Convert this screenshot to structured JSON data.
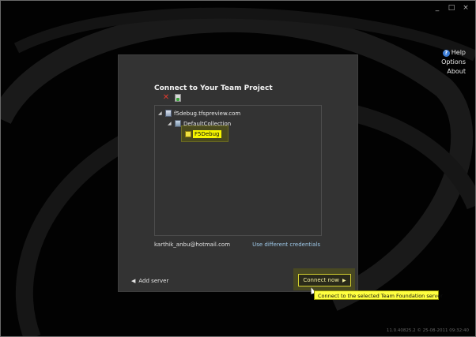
{
  "window": {
    "minimize": "_",
    "maximize": "□",
    "close": "×"
  },
  "links": {
    "help": "Help",
    "options": "Options",
    "about": "About"
  },
  "dialog": {
    "title": "Connect to Your Team Project",
    "tree": {
      "server": "f5debug.tfspreview.com",
      "collection": "DefaultCollection",
      "project": "F5Debug"
    },
    "account": "karthik_anbu@hotmail.com",
    "use_different_credentials": "Use different credentials",
    "add_server": "Add server",
    "connect_now": "Connect now",
    "tooltip": "Connect to the selected Team Foundation server"
  },
  "version_text": "11.0.40825.2 © 25-08-2011 09:32:40",
  "colors": {
    "panel": "#333333",
    "highlight": "#f5f500",
    "link": "#9ec8e8"
  }
}
